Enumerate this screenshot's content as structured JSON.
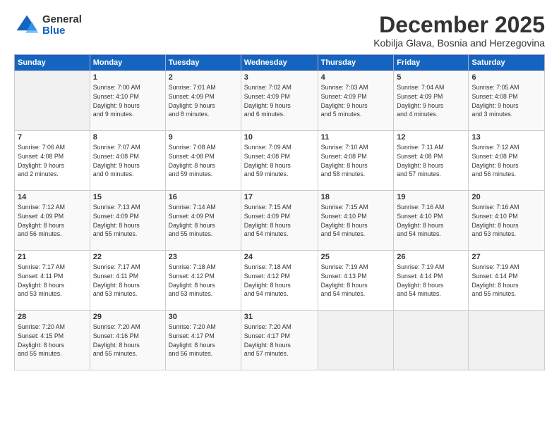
{
  "logo": {
    "general": "General",
    "blue": "Blue"
  },
  "header": {
    "month": "December 2025",
    "location": "Kobilja Glava, Bosnia and Herzegovina"
  },
  "weekdays": [
    "Sunday",
    "Monday",
    "Tuesday",
    "Wednesday",
    "Thursday",
    "Friday",
    "Saturday"
  ],
  "weeks": [
    [
      {
        "day": "",
        "info": ""
      },
      {
        "day": "1",
        "info": "Sunrise: 7:00 AM\nSunset: 4:10 PM\nDaylight: 9 hours\nand 9 minutes."
      },
      {
        "day": "2",
        "info": "Sunrise: 7:01 AM\nSunset: 4:09 PM\nDaylight: 9 hours\nand 8 minutes."
      },
      {
        "day": "3",
        "info": "Sunrise: 7:02 AM\nSunset: 4:09 PM\nDaylight: 9 hours\nand 6 minutes."
      },
      {
        "day": "4",
        "info": "Sunrise: 7:03 AM\nSunset: 4:09 PM\nDaylight: 9 hours\nand 5 minutes."
      },
      {
        "day": "5",
        "info": "Sunrise: 7:04 AM\nSunset: 4:09 PM\nDaylight: 9 hours\nand 4 minutes."
      },
      {
        "day": "6",
        "info": "Sunrise: 7:05 AM\nSunset: 4:08 PM\nDaylight: 9 hours\nand 3 minutes."
      }
    ],
    [
      {
        "day": "7",
        "info": "Sunrise: 7:06 AM\nSunset: 4:08 PM\nDaylight: 9 hours\nand 2 minutes."
      },
      {
        "day": "8",
        "info": "Sunrise: 7:07 AM\nSunset: 4:08 PM\nDaylight: 9 hours\nand 0 minutes."
      },
      {
        "day": "9",
        "info": "Sunrise: 7:08 AM\nSunset: 4:08 PM\nDaylight: 8 hours\nand 59 minutes."
      },
      {
        "day": "10",
        "info": "Sunrise: 7:09 AM\nSunset: 4:08 PM\nDaylight: 8 hours\nand 59 minutes."
      },
      {
        "day": "11",
        "info": "Sunrise: 7:10 AM\nSunset: 4:08 PM\nDaylight: 8 hours\nand 58 minutes."
      },
      {
        "day": "12",
        "info": "Sunrise: 7:11 AM\nSunset: 4:08 PM\nDaylight: 8 hours\nand 57 minutes."
      },
      {
        "day": "13",
        "info": "Sunrise: 7:12 AM\nSunset: 4:08 PM\nDaylight: 8 hours\nand 56 minutes."
      }
    ],
    [
      {
        "day": "14",
        "info": "Sunrise: 7:12 AM\nSunset: 4:09 PM\nDaylight: 8 hours\nand 56 minutes."
      },
      {
        "day": "15",
        "info": "Sunrise: 7:13 AM\nSunset: 4:09 PM\nDaylight: 8 hours\nand 55 minutes."
      },
      {
        "day": "16",
        "info": "Sunrise: 7:14 AM\nSunset: 4:09 PM\nDaylight: 8 hours\nand 55 minutes."
      },
      {
        "day": "17",
        "info": "Sunrise: 7:15 AM\nSunset: 4:09 PM\nDaylight: 8 hours\nand 54 minutes."
      },
      {
        "day": "18",
        "info": "Sunrise: 7:15 AM\nSunset: 4:10 PM\nDaylight: 8 hours\nand 54 minutes."
      },
      {
        "day": "19",
        "info": "Sunrise: 7:16 AM\nSunset: 4:10 PM\nDaylight: 8 hours\nand 54 minutes."
      },
      {
        "day": "20",
        "info": "Sunrise: 7:16 AM\nSunset: 4:10 PM\nDaylight: 8 hours\nand 53 minutes."
      }
    ],
    [
      {
        "day": "21",
        "info": "Sunrise: 7:17 AM\nSunset: 4:11 PM\nDaylight: 8 hours\nand 53 minutes."
      },
      {
        "day": "22",
        "info": "Sunrise: 7:17 AM\nSunset: 4:11 PM\nDaylight: 8 hours\nand 53 minutes."
      },
      {
        "day": "23",
        "info": "Sunrise: 7:18 AM\nSunset: 4:12 PM\nDaylight: 8 hours\nand 53 minutes."
      },
      {
        "day": "24",
        "info": "Sunrise: 7:18 AM\nSunset: 4:12 PM\nDaylight: 8 hours\nand 54 minutes."
      },
      {
        "day": "25",
        "info": "Sunrise: 7:19 AM\nSunset: 4:13 PM\nDaylight: 8 hours\nand 54 minutes."
      },
      {
        "day": "26",
        "info": "Sunrise: 7:19 AM\nSunset: 4:14 PM\nDaylight: 8 hours\nand 54 minutes."
      },
      {
        "day": "27",
        "info": "Sunrise: 7:19 AM\nSunset: 4:14 PM\nDaylight: 8 hours\nand 55 minutes."
      }
    ],
    [
      {
        "day": "28",
        "info": "Sunrise: 7:20 AM\nSunset: 4:15 PM\nDaylight: 8 hours\nand 55 minutes."
      },
      {
        "day": "29",
        "info": "Sunrise: 7:20 AM\nSunset: 4:16 PM\nDaylight: 8 hours\nand 55 minutes."
      },
      {
        "day": "30",
        "info": "Sunrise: 7:20 AM\nSunset: 4:17 PM\nDaylight: 8 hours\nand 56 minutes."
      },
      {
        "day": "31",
        "info": "Sunrise: 7:20 AM\nSunset: 4:17 PM\nDaylight: 8 hours\nand 57 minutes."
      },
      {
        "day": "",
        "info": ""
      },
      {
        "day": "",
        "info": ""
      },
      {
        "day": "",
        "info": ""
      }
    ]
  ]
}
